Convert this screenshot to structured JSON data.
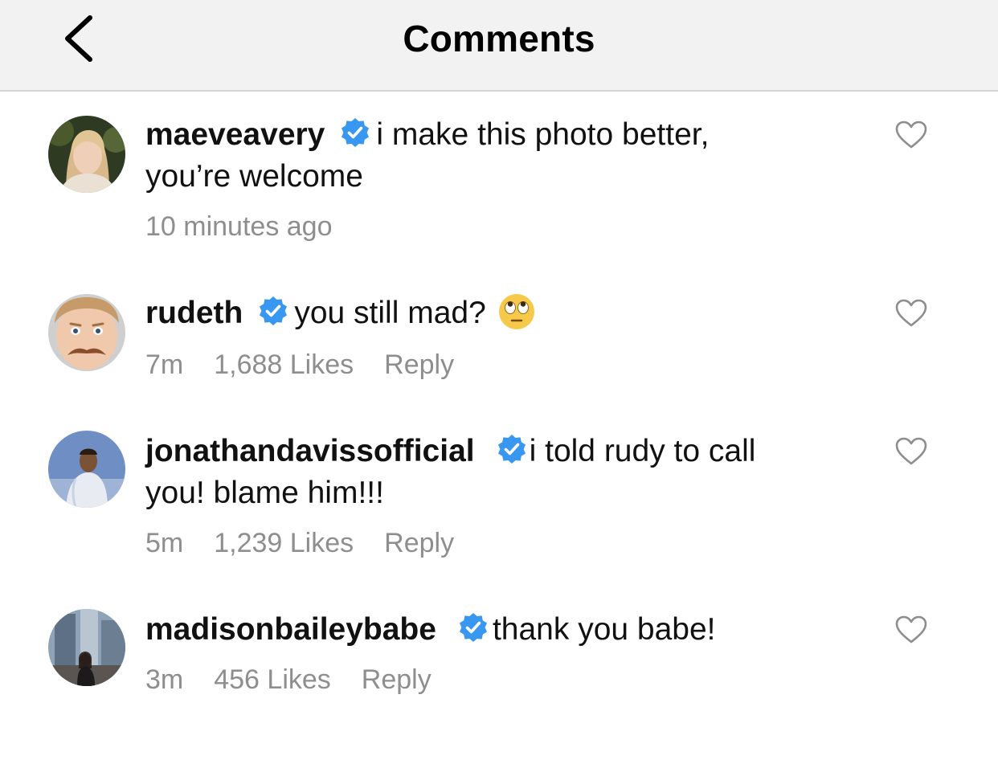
{
  "header": {
    "title": "Comments"
  },
  "icons": {
    "back": "chevron-left-icon",
    "verified": "verified-badge-icon",
    "like": "heart-outline-icon"
  },
  "colors": {
    "verified": "#3897f0",
    "meta": "#8e8e8e",
    "header_bg": "#f2f2f2"
  },
  "comments": [
    {
      "username": "maeveavery",
      "verified": true,
      "text_line1": "i make this photo better,",
      "text_line2": "you’re welcome",
      "time": "10 minutes ago"
    },
    {
      "username": "rudeth",
      "verified": true,
      "text": "you still mad?",
      "emoji": "face-with-rolling-eyes",
      "time": "7m",
      "likes": "1,688 Likes",
      "reply": "Reply"
    },
    {
      "username": "jonathandavissofficial",
      "verified": true,
      "text_line1": "i told rudy to call",
      "text_line2": "you! blame him!!!",
      "time": "5m",
      "likes": "1,239 Likes",
      "reply": "Reply"
    },
    {
      "username": "madisonbaileybabe",
      "verified": true,
      "text": "thank you babe!",
      "time": "3m",
      "likes": "456 Likes",
      "reply": "Reply"
    }
  ]
}
